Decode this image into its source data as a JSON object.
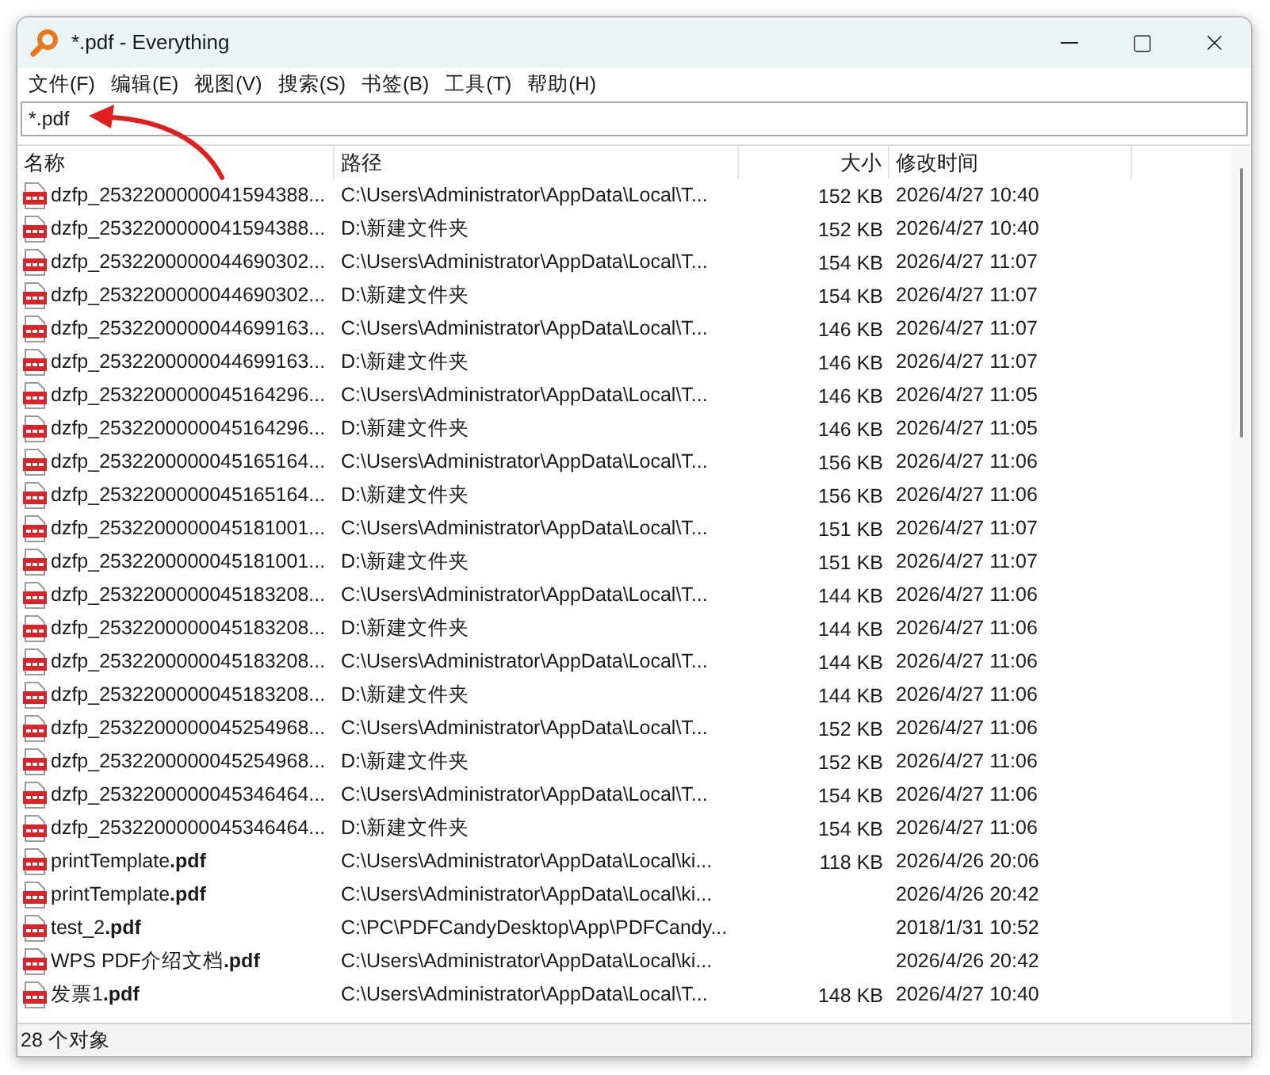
{
  "window": {
    "title": "*.pdf - Everything"
  },
  "menu": [
    "文件(F)",
    "编辑(E)",
    "视图(V)",
    "搜索(S)",
    "书签(B)",
    "工具(T)",
    "帮助(H)"
  ],
  "search": {
    "value": "*.pdf"
  },
  "table": {
    "columns": [
      "名称",
      "路径",
      "大小",
      "修改时间"
    ],
    "rows": [
      {
        "name": "dzfp_2532200000041594388...",
        "path": "C:\\Users\\Administrator\\AppData\\Local\\T...",
        "size": "152 KB",
        "modified": "2026/4/27 10:40"
      },
      {
        "name": "dzfp_2532200000041594388...",
        "path": "D:\\新建文件夹",
        "size": "152 KB",
        "modified": "2026/4/27 10:40"
      },
      {
        "name": "dzfp_2532200000044690302...",
        "path": "C:\\Users\\Administrator\\AppData\\Local\\T...",
        "size": "154 KB",
        "modified": "2026/4/27 11:07"
      },
      {
        "name": "dzfp_2532200000044690302...",
        "path": "D:\\新建文件夹",
        "size": "154 KB",
        "modified": "2026/4/27 11:07"
      },
      {
        "name": "dzfp_2532200000044699163...",
        "path": "C:\\Users\\Administrator\\AppData\\Local\\T...",
        "size": "146 KB",
        "modified": "2026/4/27 11:07"
      },
      {
        "name": "dzfp_2532200000044699163...",
        "path": "D:\\新建文件夹",
        "size": "146 KB",
        "modified": "2026/4/27 11:07"
      },
      {
        "name": "dzfp_2532200000045164296...",
        "path": "C:\\Users\\Administrator\\AppData\\Local\\T...",
        "size": "146 KB",
        "modified": "2026/4/27 11:05"
      },
      {
        "name": "dzfp_2532200000045164296...",
        "path": "D:\\新建文件夹",
        "size": "146 KB",
        "modified": "2026/4/27 11:05"
      },
      {
        "name": "dzfp_2532200000045165164...",
        "path": "C:\\Users\\Administrator\\AppData\\Local\\T...",
        "size": "156 KB",
        "modified": "2026/4/27 11:06"
      },
      {
        "name": "dzfp_2532200000045165164...",
        "path": "D:\\新建文件夹",
        "size": "156 KB",
        "modified": "2026/4/27 11:06"
      },
      {
        "name": "dzfp_2532200000045181001...",
        "path": "C:\\Users\\Administrator\\AppData\\Local\\T...",
        "size": "151 KB",
        "modified": "2026/4/27 11:07"
      },
      {
        "name": "dzfp_2532200000045181001...",
        "path": "D:\\新建文件夹",
        "size": "151 KB",
        "modified": "2026/4/27 11:07"
      },
      {
        "name": "dzfp_2532200000045183208...",
        "path": "C:\\Users\\Administrator\\AppData\\Local\\T...",
        "size": "144 KB",
        "modified": "2026/4/27 11:06"
      },
      {
        "name": "dzfp_2532200000045183208...",
        "path": "D:\\新建文件夹",
        "size": "144 KB",
        "modified": "2026/4/27 11:06"
      },
      {
        "name": "dzfp_2532200000045183208...",
        "path": "C:\\Users\\Administrator\\AppData\\Local\\T...",
        "size": "144 KB",
        "modified": "2026/4/27 11:06"
      },
      {
        "name": "dzfp_2532200000045183208...",
        "path": "D:\\新建文件夹",
        "size": "144 KB",
        "modified": "2026/4/27 11:06"
      },
      {
        "name": "dzfp_2532200000045254968...",
        "path": "C:\\Users\\Administrator\\AppData\\Local\\T...",
        "size": "152 KB",
        "modified": "2026/4/27 11:06"
      },
      {
        "name": "dzfp_2532200000045254968...",
        "path": "D:\\新建文件夹",
        "size": "152 KB",
        "modified": "2026/4/27 11:06"
      },
      {
        "name": "dzfp_2532200000045346464...",
        "path": "C:\\Users\\Administrator\\AppData\\Local\\T...",
        "size": "154 KB",
        "modified": "2026/4/27 11:06"
      },
      {
        "name": "dzfp_2532200000045346464...",
        "path": "D:\\新建文件夹",
        "size": "154 KB",
        "modified": "2026/4/27 11:06"
      },
      {
        "name": "printTemplate**.pdf**",
        "path": "C:\\Users\\Administrator\\AppData\\Local\\ki...",
        "size": "118 KB",
        "modified": "2026/4/26 20:06"
      },
      {
        "name": "printTemplate**.pdf**",
        "path": "C:\\Users\\Administrator\\AppData\\Local\\ki...",
        "modified": "2026/4/26 20:42"
      },
      {
        "name": "test_2**.pdf**",
        "path": "C:\\PC\\PDFCandyDesktop\\App\\PDFCandy...",
        "modified": "2018/1/31 10:52"
      },
      {
        "name": "WPS PDF介绍文档**.pdf**",
        "path": "C:\\Users\\Administrator\\AppData\\Local\\ki...",
        "modified": "2026/4/26 20:42"
      },
      {
        "name": "发票1**.pdf**",
        "path": "C:\\Users\\Administrator\\AppData\\Local\\T...",
        "size": "148 KB",
        "modified": "2026/4/27 10:40"
      }
    ]
  },
  "status_bar": "28 个对象"
}
